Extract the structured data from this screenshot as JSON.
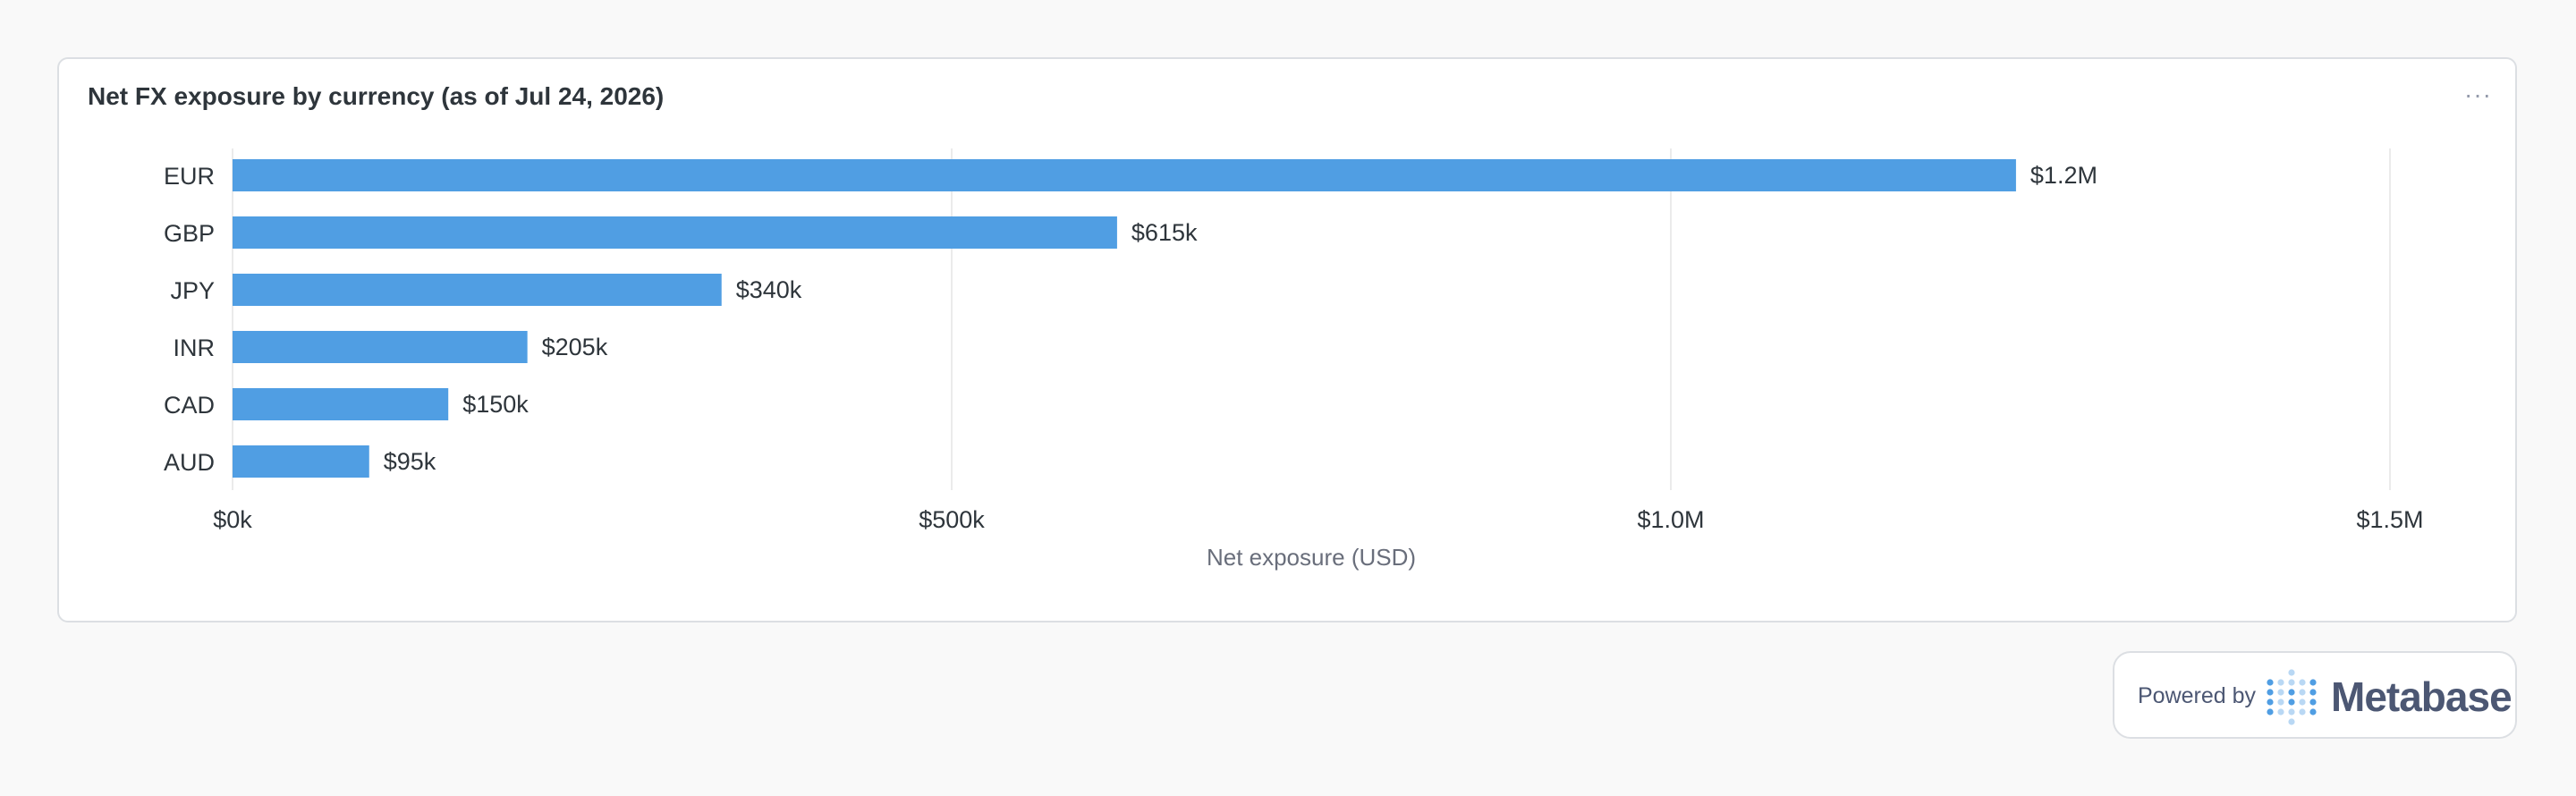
{
  "card": {
    "title": "Net FX exposure by currency (as of Jul 24, 2026)",
    "menu_label": "···"
  },
  "chart_data": {
    "type": "bar",
    "orientation": "horizontal",
    "title": "Net FX exposure by currency (as of Jul 24, 2026)",
    "xlabel": "Net exposure (USD)",
    "ylabel": "",
    "categories": [
      "EUR",
      "GBP",
      "JPY",
      "INR",
      "CAD",
      "AUD"
    ],
    "values": [
      1240000,
      615000,
      340000,
      205000,
      150000,
      95000
    ],
    "data_labels": [
      "$1.2M",
      "$615k",
      "$340k",
      "$205k",
      "$150k",
      "$95k"
    ],
    "xlim": [
      0,
      1500000
    ],
    "x_ticks": [
      0,
      500000,
      1000000,
      1500000
    ],
    "x_tick_labels": [
      "$0k",
      "$500k",
      "$1.0M",
      "$1.5M"
    ],
    "grid": "vertical",
    "bar_color": "#509ee3",
    "grid_color": "#ebebeb"
  },
  "footer": {
    "powered_by": "Powered by",
    "brand": "Metabase",
    "brand_icon": "metabase-logo-icon"
  }
}
